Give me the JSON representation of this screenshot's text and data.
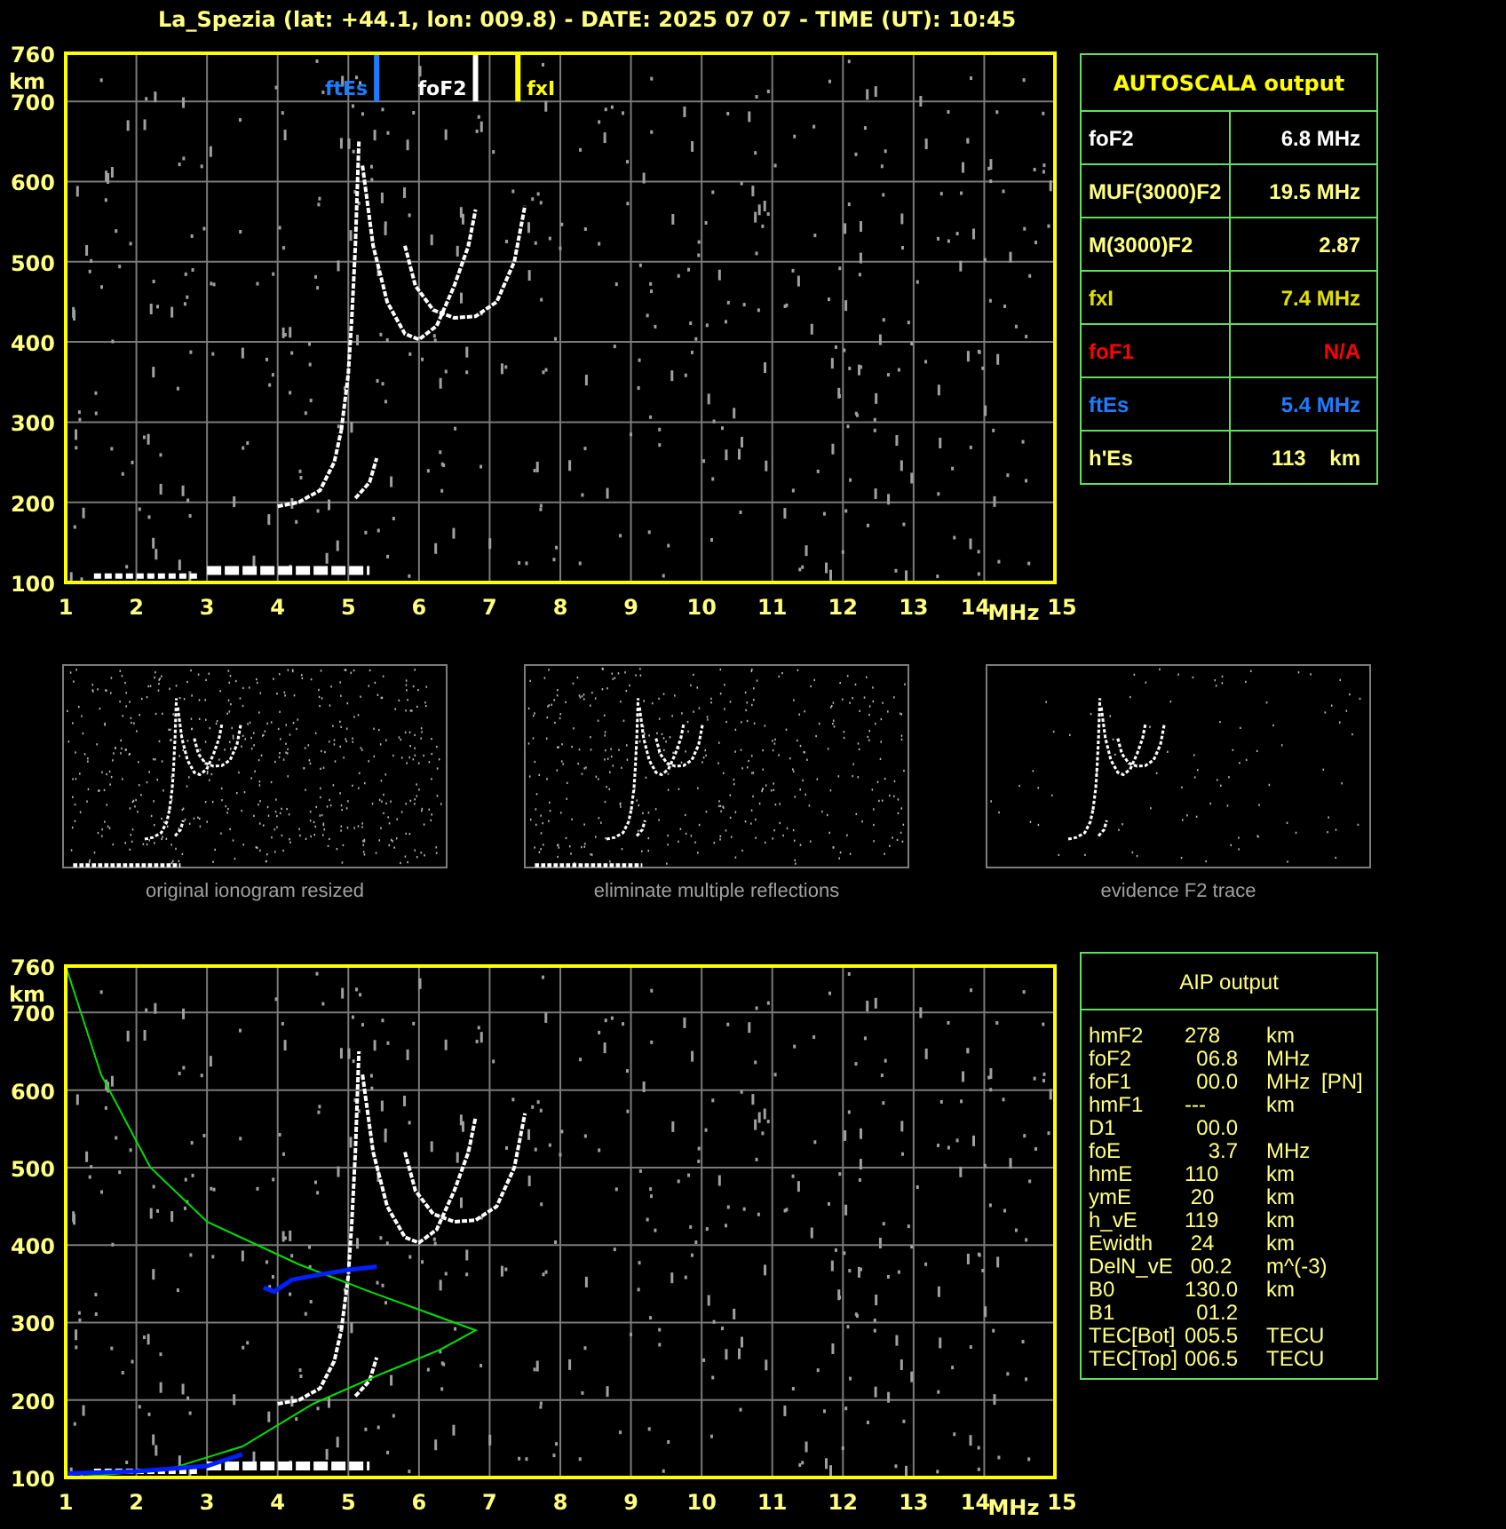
{
  "title": "La_Spezia (lat: +44.1, lon: 009.8) - DATE: 2025 07 07 - TIME (UT): 10:45",
  "ionogram": {
    "y_unit": "km",
    "x_unit": "MHz",
    "yticks": [
      "760",
      "700",
      "600",
      "500",
      "400",
      "300",
      "200",
      "100"
    ],
    "xticks": [
      "1",
      "2",
      "3",
      "4",
      "5",
      "6",
      "7",
      "8",
      "9",
      "10",
      "11",
      "12",
      "13",
      "14",
      "15"
    ],
    "markers": [
      {
        "label": "ftEs",
        "color": "#1e7cff"
      },
      {
        "label": "foF2",
        "color": "#ffffff"
      },
      {
        "label": "fxI",
        "color": "#ffff00"
      }
    ]
  },
  "autoscala": {
    "title": "AUTOSCALA output",
    "rows": [
      {
        "name": "foF2",
        "value": "6.8 MHz",
        "color": "#ffffff"
      },
      {
        "name": "MUF(3000)F2",
        "value": "19.5 MHz",
        "color": "#ffff80"
      },
      {
        "name": "M(3000)F2",
        "value": "2.87",
        "color": "#ffff80"
      },
      {
        "name": "fxI",
        "value": "7.4 MHz",
        "color": "#e0e000"
      },
      {
        "name": "foF1",
        "value": "N/A",
        "color": "#ff0000"
      },
      {
        "name": "ftEs",
        "value": "5.4 MHz",
        "color": "#1e7cff"
      },
      {
        "name": "h'Es",
        "value": "113    km",
        "color": "#ffff80"
      }
    ]
  },
  "thumbnails": [
    {
      "caption": "original ionogram resized"
    },
    {
      "caption": "eliminate multiple reflections"
    },
    {
      "caption": "evidence F2 trace"
    }
  ],
  "profile_ionogram": {
    "y_unit": "km",
    "x_unit": "MHz",
    "yticks": [
      "760",
      "700",
      "600",
      "500",
      "400",
      "300",
      "200",
      "100"
    ],
    "xticks": [
      "1",
      "2",
      "3",
      "4",
      "5",
      "6",
      "7",
      "8",
      "9",
      "10",
      "11",
      "12",
      "13",
      "14",
      "15"
    ]
  },
  "aip": {
    "title": "AIP output",
    "rows": [
      {
        "name": "hmF2",
        "value": "278",
        "unit": "km"
      },
      {
        "name": "foF2",
        "value": "  06.8",
        "unit": "MHz"
      },
      {
        "name": "foF1",
        "value": "  00.0",
        "unit": "MHz",
        "note": "[PN]"
      },
      {
        "name": "hmF1",
        "value": "---",
        "unit": "km"
      },
      {
        "name": "D1",
        "value": "  00.0"
      },
      {
        "name": "foE",
        "value": "    3.7",
        "unit": "MHz"
      },
      {
        "name": "hmE",
        "value": "110",
        "unit": "km"
      },
      {
        "name": "ymE",
        "value": " 20",
        "unit": "km"
      },
      {
        "name": "h_vE",
        "value": "119",
        "unit": "km"
      },
      {
        "name": "Ewidth",
        "value": " 24",
        "unit": "km"
      },
      {
        "name": "DelN_vE",
        "value": " 00.2",
        "unit": "m^(-3)"
      },
      {
        "name": "B0",
        "value": "130.0",
        "unit": "km"
      },
      {
        "name": "B1",
        "value": "  01.2"
      },
      {
        "name": "TEC[Bot]",
        "value": "005.5",
        "unit": "TECU"
      },
      {
        "name": "TEC[Top]",
        "value": "006.5",
        "unit": "TECU"
      }
    ]
  }
}
